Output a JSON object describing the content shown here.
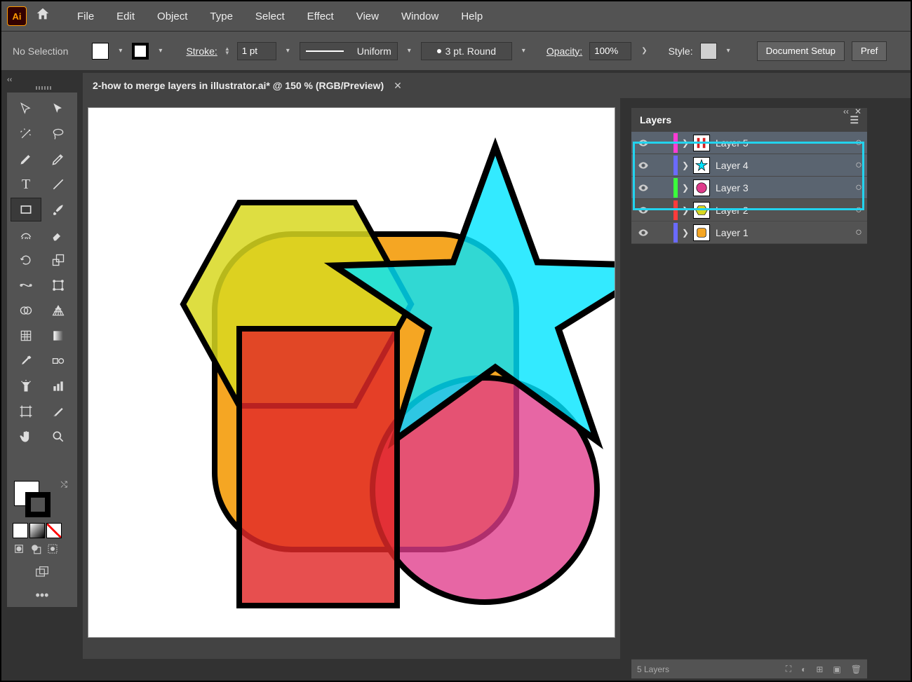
{
  "menubar": {
    "items": [
      "File",
      "Edit",
      "Object",
      "Type",
      "Select",
      "Effect",
      "View",
      "Window",
      "Help"
    ]
  },
  "controlbar": {
    "selection_state": "No Selection",
    "stroke_label": "Stroke:",
    "stroke_weight": "1 pt",
    "profile_label": "Uniform",
    "brush_label": "3 pt. Round",
    "opacity_label": "Opacity:",
    "opacity_value": "100%",
    "style_label": "Style:",
    "doc_setup": "Document Setup",
    "prefs": "Pref"
  },
  "document": {
    "tab_title": "2-how to merge layers in illustrator.ai* @ 150 % (RGB/Preview)"
  },
  "layers_panel": {
    "title": "Layers",
    "footer_count": "5 Layers",
    "rows": [
      {
        "name": "Layer 5",
        "color": "#ff3bd4",
        "selected": true,
        "thumb": "stripes"
      },
      {
        "name": "Layer 4",
        "color": "#6a6aff",
        "selected": true,
        "thumb": "star"
      },
      {
        "name": "Layer 3",
        "color": "#3bff3b",
        "selected": true,
        "thumb": "circle"
      },
      {
        "name": "Layer 2",
        "color": "#ff3b3b",
        "selected": false,
        "thumb": "hex"
      },
      {
        "name": "Layer 1",
        "color": "#6a6aff",
        "selected": false,
        "thumb": "square"
      }
    ]
  },
  "canvas_shapes": {
    "hexagon_color": "#d8d820",
    "rounded_rect_color": "#f5a623",
    "star_color": "#00e5ff",
    "green_hint": "#1aa94a",
    "circle_color": "#e03b8b",
    "dark_red": "#d82020",
    "overlap_opacity": 0.85
  }
}
